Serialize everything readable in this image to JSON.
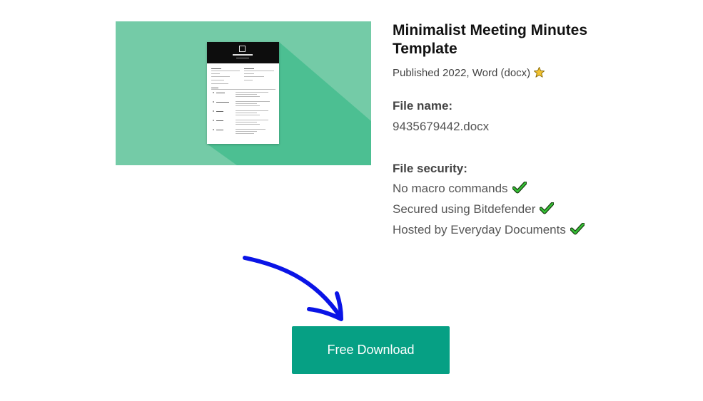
{
  "template": {
    "title": "Minimalist Meeting Minutes Template",
    "published": "Published 2022, Word (docx)",
    "published_icon": "star-icon"
  },
  "file_name": {
    "label": "File name:",
    "value": "9435679442.docx"
  },
  "file_security": {
    "label": "File security:",
    "items": [
      {
        "text": "No macro commands",
        "icon": "check-icon"
      },
      {
        "text": "Secured using Bitdefender",
        "icon": "check-icon"
      },
      {
        "text": "Hosted by Everyday Documents",
        "icon": "check-icon"
      }
    ]
  },
  "download_button": {
    "label": "Free Download"
  },
  "colors": {
    "preview_bg": "#74cba7",
    "preview_shadow": "#4cbf92",
    "button_bg": "#06a084",
    "arrow": "#0a14e6",
    "check": "#2fb82f",
    "star": "#f2c230"
  }
}
